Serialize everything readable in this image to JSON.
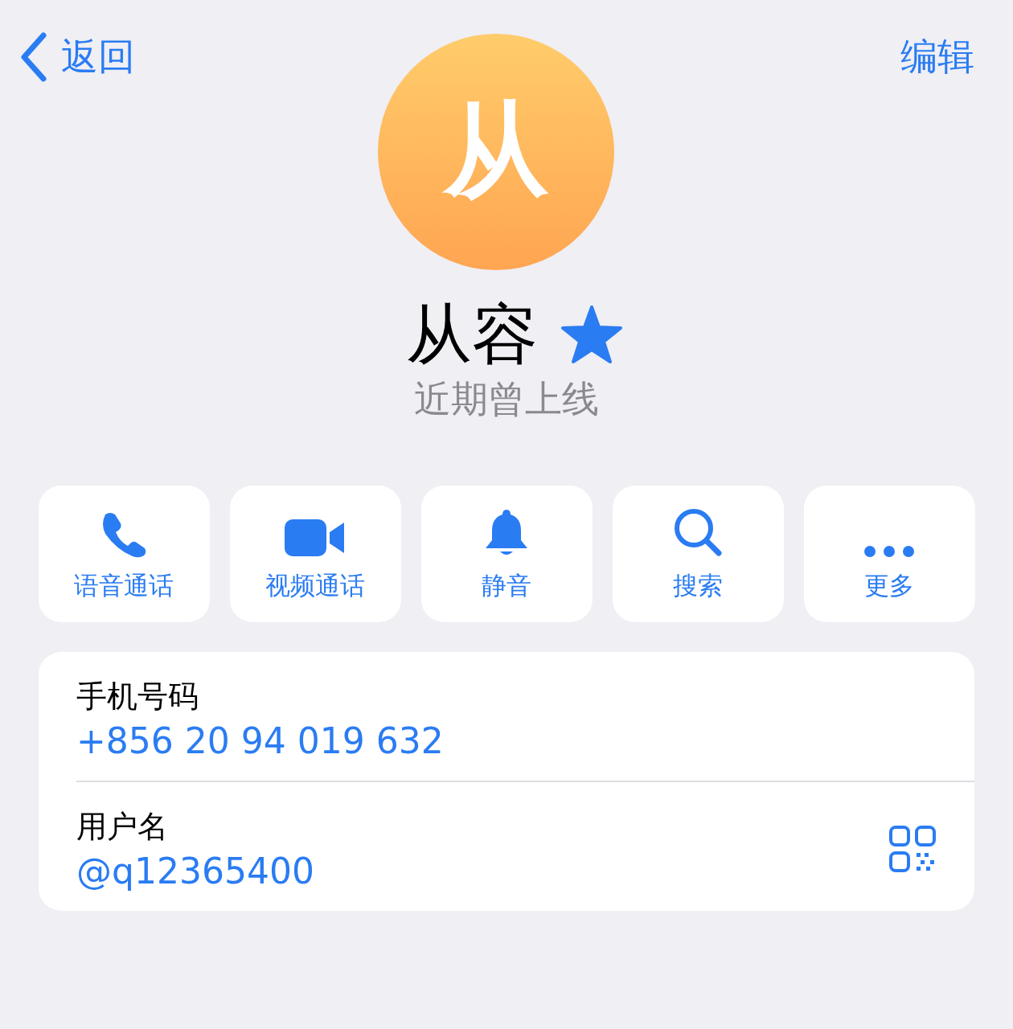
{
  "nav": {
    "back": "返回",
    "edit": "编辑"
  },
  "avatar": {
    "initial": "从"
  },
  "profile": {
    "name": "从容",
    "status": "近期曾上线"
  },
  "actions": [
    {
      "kind": "call",
      "label": "语音通话"
    },
    {
      "kind": "video",
      "label": "视频通话"
    },
    {
      "kind": "mute",
      "label": "静音"
    },
    {
      "kind": "search",
      "label": "搜索"
    },
    {
      "kind": "more",
      "label": "更多"
    }
  ],
  "info": [
    {
      "label": "手机号码",
      "value": "+856 20 94 019 632",
      "qr": false
    },
    {
      "label": "用户名",
      "value": "@q12365400",
      "qr": true
    }
  ]
}
